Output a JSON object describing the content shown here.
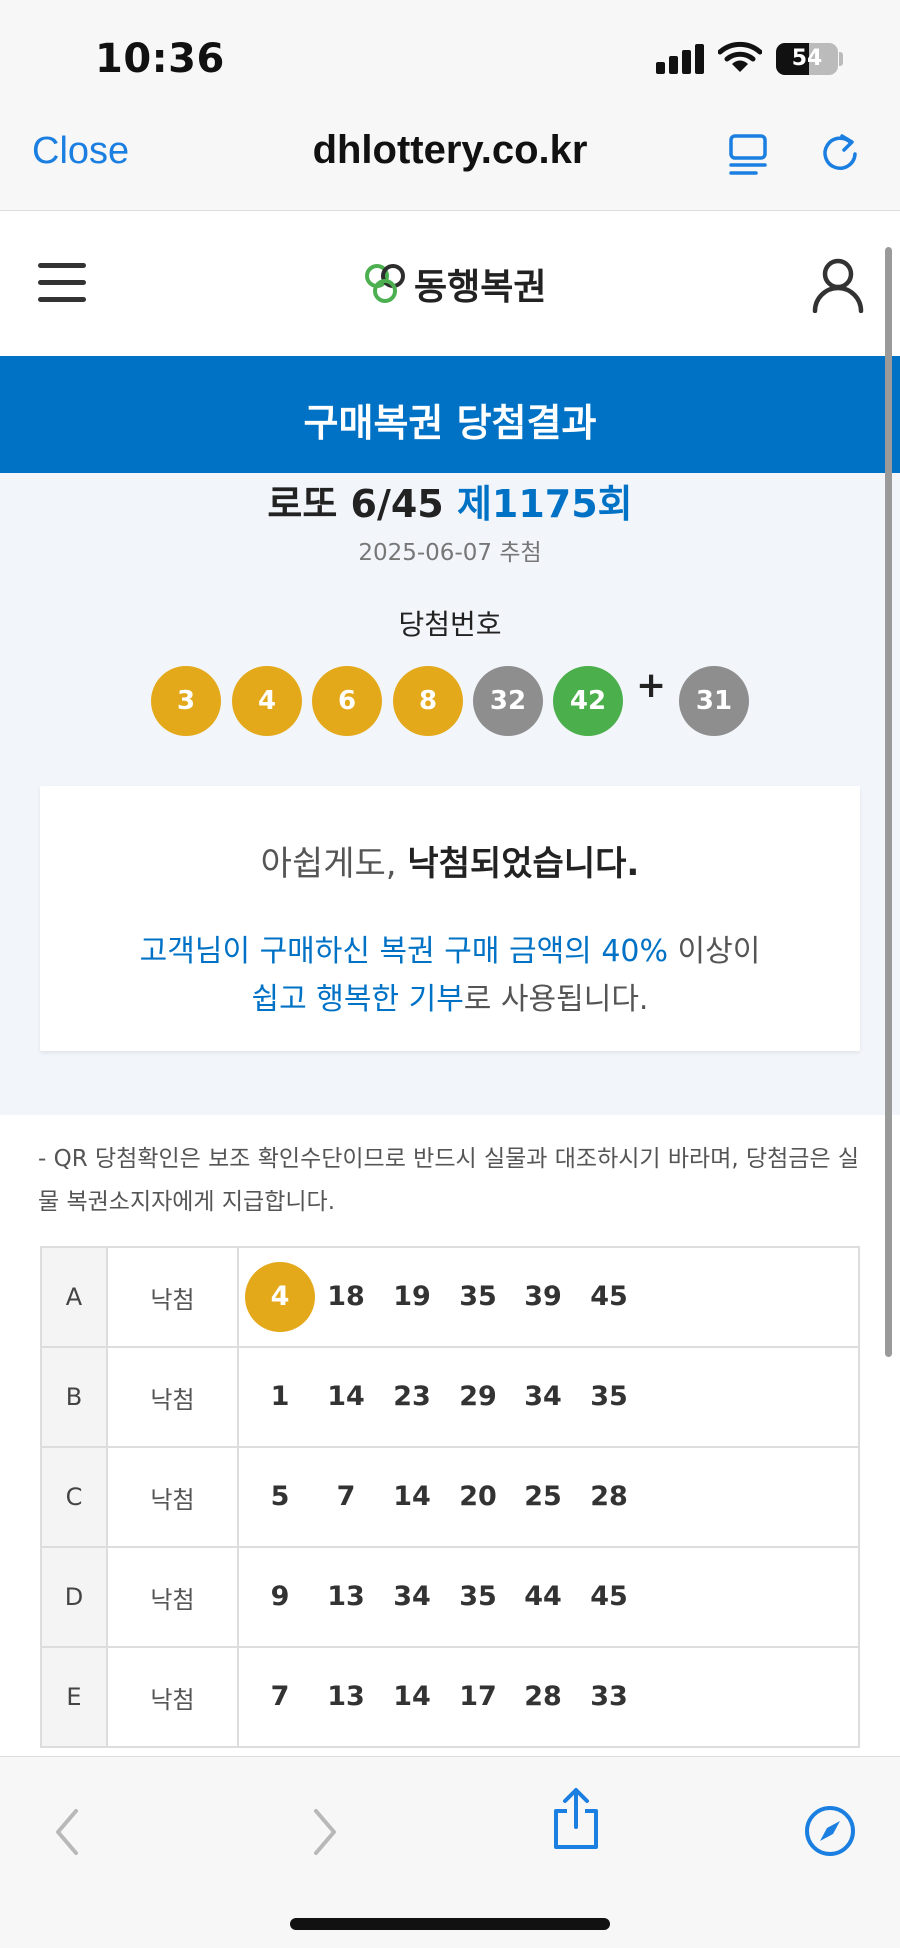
{
  "status_bar": {
    "time": "10:36",
    "battery": "54"
  },
  "browser": {
    "close_label": "Close",
    "url": "dhlottery.co.kr"
  },
  "site": {
    "logo_text": "동행복권",
    "logo_colors": {
      "green": "#4caf50",
      "dark": "#2e2e2e"
    }
  },
  "banner": {
    "title": "구매복권 당첨결과"
  },
  "result": {
    "game": "로또 6/45",
    "round": "제1175회",
    "draw_date": "2025-06-07 추첨",
    "winning_label": "당첨번호",
    "plus": "+",
    "balls": [
      {
        "value": "3",
        "color": "#e4a81b"
      },
      {
        "value": "4",
        "color": "#e4a81b"
      },
      {
        "value": "6",
        "color": "#e4a81b"
      },
      {
        "value": "8",
        "color": "#e4a81b"
      },
      {
        "value": "32",
        "color": "#8e8e8e"
      },
      {
        "value": "42",
        "color": "#4bb04b"
      }
    ],
    "bonus": {
      "value": "31",
      "color": "#8e8e8e"
    }
  },
  "message": {
    "lead": "아쉽게도,",
    "main_bold": "낙첨되었습니다.",
    "line1_blue": "고객님이 구매하신 복권 구매 금액의 40%",
    "line1_rest": " 이상이",
    "line2_blue": "쉽고 행복한 기부",
    "line2_rest": "로 사용됩니다."
  },
  "notice": "- QR 당첨확인은 보조 확인수단이므로 반드시 실물과 대조하시기 바라며, 당첨금은 실물 복권소지자에게 지급합니다.",
  "tickets": [
    {
      "row": "A",
      "result": "낙첨",
      "numbers": [
        "4",
        "18",
        "19",
        "35",
        "39",
        "45"
      ],
      "hits": [
        true,
        false,
        false,
        false,
        false,
        false
      ]
    },
    {
      "row": "B",
      "result": "낙첨",
      "numbers": [
        "1",
        "14",
        "23",
        "29",
        "34",
        "35"
      ],
      "hits": [
        false,
        false,
        false,
        false,
        false,
        false
      ]
    },
    {
      "row": "C",
      "result": "낙첨",
      "numbers": [
        "5",
        "7",
        "14",
        "20",
        "25",
        "28"
      ],
      "hits": [
        false,
        false,
        false,
        false,
        false,
        false
      ]
    },
    {
      "row": "D",
      "result": "낙첨",
      "numbers": [
        "9",
        "13",
        "34",
        "35",
        "44",
        "45"
      ],
      "hits": [
        false,
        false,
        false,
        false,
        false,
        false
      ]
    },
    {
      "row": "E",
      "result": "낙첨",
      "numbers": [
        "7",
        "13",
        "14",
        "17",
        "28",
        "33"
      ],
      "hits": [
        false,
        false,
        false,
        false,
        false,
        false
      ]
    }
  ],
  "toolbar": {
    "icons": [
      "back-icon",
      "forward-icon",
      "share-icon",
      "compass-icon"
    ]
  },
  "colors": {
    "accent": "#0072c6",
    "ios_blue": "#1a7fe0",
    "yellow_ball": "#e4a81b",
    "gray_ball": "#8e8e8e",
    "green_ball": "#4bb04b"
  }
}
